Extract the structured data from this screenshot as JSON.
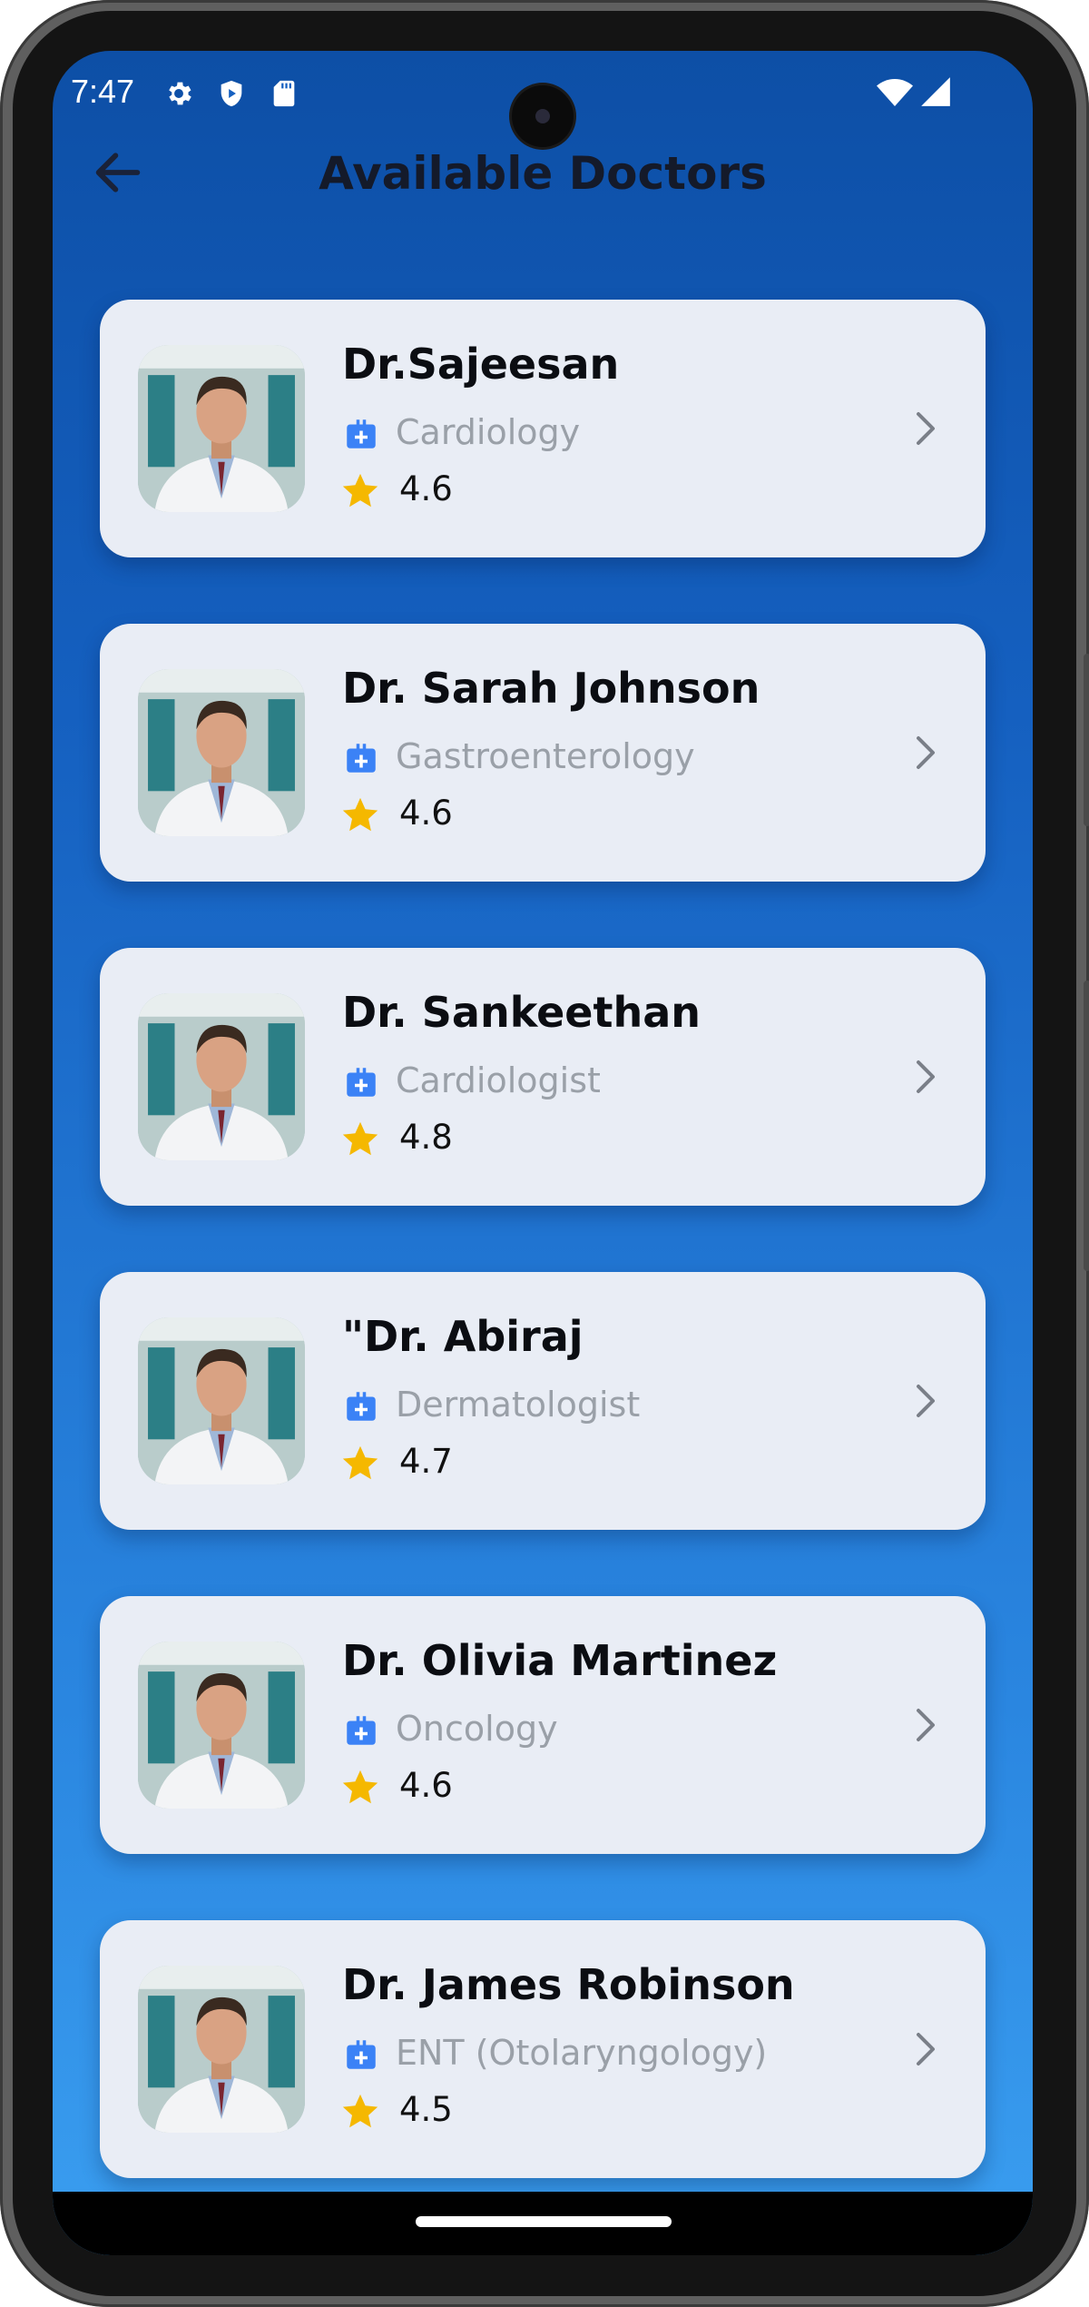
{
  "status_bar": {
    "time": "7:47",
    "icons": [
      "gear-icon",
      "shield-icon",
      "sd-card-icon",
      "wifi-icon",
      "signal-icon"
    ]
  },
  "header": {
    "title": "Available Doctors",
    "back_icon": "arrow-left-icon"
  },
  "colors": {
    "background_top": "#0d4fa6",
    "background_bottom": "#3a9ef0",
    "card": "#e9edf5",
    "accent_icon": "#3b82f6",
    "star": "#f5b800",
    "specialty_text": "#9aa0a8"
  },
  "doctors": [
    {
      "name": "Dr.Sajeesan",
      "specialty": "Cardiology",
      "rating": "4.6"
    },
    {
      "name": "Dr. Sarah Johnson",
      "specialty": "Gastroenterology",
      "rating": "4.6"
    },
    {
      "name": "Dr. Sankeethan",
      "specialty": "Cardiologist",
      "rating": "4.8"
    },
    {
      "name": "\"Dr. Abiraj",
      "specialty": "Dermatologist",
      "rating": "4.7"
    },
    {
      "name": "Dr. Olivia Martinez",
      "specialty": "Oncology",
      "rating": "4.6"
    },
    {
      "name": "Dr. James Robinson",
      "specialty": "ENT (Otolaryngology)",
      "rating": "4.5"
    }
  ]
}
